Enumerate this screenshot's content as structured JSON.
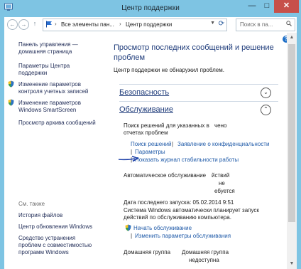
{
  "window": {
    "title": "Центр поддержки",
    "buttons": {
      "minimize": "—",
      "maximize": "□",
      "close": "✕"
    }
  },
  "nav": {
    "breadcrumb": [
      "Все элементы пан...",
      "Центр поддержки"
    ],
    "search_placeholder": "Поиск в па..."
  },
  "sidebar": {
    "items": [
      {
        "label": "Панель управления —\nдомашняя страница",
        "shield": false
      },
      {
        "label": "Параметры Центра\nподдержки",
        "shield": false
      },
      {
        "label": "Изменение параметров\nконтроля учетных записей",
        "shield": true
      },
      {
        "label": "Изменение параметров\nWindows SmartScreen",
        "shield": true
      },
      {
        "label": "Просмотр архива сообщений",
        "shield": false
      }
    ],
    "see_also": "См. также",
    "see_also_items": [
      "История файлов",
      "Центр обновления Windows",
      "Средство устранения\nпроблем с совместимостью\nпрограмм Windows"
    ]
  },
  "main": {
    "heading": "Просмотр последних сообщений и решение\nпроблем",
    "status": "Центр поддержки не обнаружил проблем.",
    "security": {
      "title": "Безопасность"
    },
    "maintenance": {
      "title": "Обслуживание",
      "search_text_1": "Поиск решений для указанных в",
      "search_text_1_tail": "чено",
      "search_text_2": "отчетах проблем",
      "links_1": [
        "Поиск решений",
        "Заявление о конфиденциальности"
      ],
      "links_2": "Параметры",
      "links_3": "Показать журнал стабильности работы",
      "auto_label": "Автоматическое обслуживание",
      "auto_tail_1": "йствий",
      "auto_tail_2": "не",
      "auto_tail_3": "ебуется",
      "last_run": "Дата последнего запуска: 05.02.2014 9:51",
      "desc_1": "Система Windows автоматически планирует запуск",
      "desc_2": "действий по обслуживанию компьютера.",
      "start_link": "Начать обслуживание",
      "change_link": "Изменить параметры обслуживания"
    },
    "homegroup": {
      "label": "Домашняя группа",
      "value_1": "Домашняя группа",
      "value_2": "недоступна"
    }
  },
  "colors": {
    "accent": "#7ec4e3",
    "link": "#1f5aa8",
    "heading": "#1e3b7a",
    "close": "#c7504a",
    "arrow": "#1c3fa8"
  }
}
